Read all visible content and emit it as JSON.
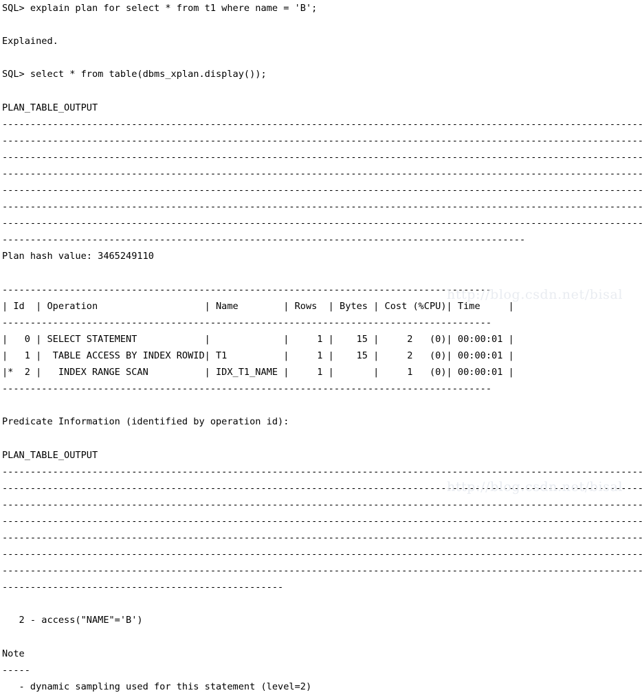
{
  "window": {
    "title": "SQL*Plus terminal output",
    "background_color": "#ffffff",
    "text_color": "#000000",
    "watermark_color": "#e9ecf1"
  },
  "watermark": {
    "text": "http://blog.csdn.net/bisal",
    "occurrences": 2
  },
  "session": {
    "prompt": "SQL>",
    "command_1": "SQL> explain plan for select * from t1 where name = 'B';",
    "result_1": "Explained.",
    "command_2": "SQL> select * from table(dbms_xplan.display());",
    "column_heading": "PLAN_TABLE_OUTPUT"
  },
  "plan": {
    "hash_label": "Plan hash value: 3465249110",
    "hash_value": "3465249110",
    "table_header": "| Id  | Operation                   | Name        | Rows  | Bytes | Cost (%CPU)| Time     |",
    "table_rule": "---------------------------------------------------------------------------------------",
    "columns": [
      "Id",
      "Operation",
      "Name",
      "Rows",
      "Bytes",
      "Cost (%CPU)",
      "Time"
    ],
    "rows": [
      {
        "line": "|   0 | SELECT STATEMENT            |             |     1 |    15 |     2   (0)| 00:00:01 |",
        "star": "",
        "id": "0",
        "operation": "SELECT STATEMENT",
        "name": "",
        "rows": "1",
        "bytes": "15",
        "cost": "2   (0)",
        "time": "00:00:01"
      },
      {
        "line": "|   1 |  TABLE ACCESS BY INDEX ROWID| T1          |     1 |    15 |     2   (0)| 00:00:01 |",
        "star": "",
        "id": "1",
        "operation": " TABLE ACCESS BY INDEX ROWID",
        "name": "T1",
        "rows": "1",
        "bytes": "15",
        "cost": "2   (0)",
        "time": "00:00:01"
      },
      {
        "line": "|*  2 |   INDEX RANGE SCAN          | IDX_T1_NAME |     1 |       |     1   (0)| 00:00:01 |",
        "star": "*",
        "id": "2",
        "operation": "  INDEX RANGE SCAN",
        "name": "IDX_T1_NAME",
        "rows": "1",
        "bytes": "",
        "cost": "1   (0)",
        "time": "00:00:01"
      }
    ]
  },
  "predicate": {
    "heading": "Predicate Information (identified by operation id):",
    "column_heading": "PLAN_TABLE_OUTPUT",
    "entries": [
      "   2 - access(\"NAME\"='B')"
    ]
  },
  "note": {
    "heading": "Note",
    "underline": "-----",
    "entries": [
      "   - dynamic sampling used for this statement (level=2)"
    ]
  },
  "separators": {
    "full_width_dashes": "------------------------------------------------------------------------------------------------------------------",
    "block1_tail_dashes": "---------------------------------------------------------------------------------------------",
    "block2_tail_dashes": "--------------------------------------------------"
  },
  "lines": [
    {
      "kind": "command",
      "text": "SQL> explain plan for select * from t1 where name = 'B';"
    },
    {
      "kind": "blank",
      "text": ""
    },
    {
      "kind": "result",
      "text": "Explained."
    },
    {
      "kind": "blank",
      "text": ""
    },
    {
      "kind": "command",
      "text": "SQL> select * from table(dbms_xplan.display());"
    },
    {
      "kind": "blank",
      "text": ""
    },
    {
      "kind": "heading",
      "text": "PLAN_TABLE_OUTPUT"
    },
    {
      "kind": "separator",
      "text": "------------------------------------------------------------------------------------------------------------------"
    },
    {
      "kind": "separator",
      "text": "------------------------------------------------------------------------------------------------------------------"
    },
    {
      "kind": "separator",
      "text": "------------------------------------------------------------------------------------------------------------------"
    },
    {
      "kind": "separator",
      "text": "------------------------------------------------------------------------------------------------------------------"
    },
    {
      "kind": "separator",
      "text": "------------------------------------------------------------------------------------------------------------------"
    },
    {
      "kind": "separator",
      "text": "------------------------------------------------------------------------------------------------------------------"
    },
    {
      "kind": "separator",
      "text": "------------------------------------------------------------------------------------------------------------------"
    },
    {
      "kind": "separator",
      "text": "---------------------------------------------------------------------------------------------"
    },
    {
      "kind": "planhash",
      "text": "Plan hash value: 3465249110"
    },
    {
      "kind": "blank",
      "text": ""
    },
    {
      "kind": "tablerule",
      "text": "---------------------------------------------------------------------------------------"
    },
    {
      "kind": "tablehead",
      "text": "| Id  | Operation                   | Name        | Rows  | Bytes | Cost (%CPU)| Time     |"
    },
    {
      "kind": "tablerule",
      "text": "---------------------------------------------------------------------------------------"
    },
    {
      "kind": "tablerow",
      "text": "|   0 | SELECT STATEMENT            |             |     1 |    15 |     2   (0)| 00:00:01 |"
    },
    {
      "kind": "tablerow",
      "text": "|   1 |  TABLE ACCESS BY INDEX ROWID| T1          |     1 |    15 |     2   (0)| 00:00:01 |"
    },
    {
      "kind": "tablerow",
      "text": "|*  2 |   INDEX RANGE SCAN          | IDX_T1_NAME |     1 |       |     1   (0)| 00:00:01 |"
    },
    {
      "kind": "tablerule",
      "text": "---------------------------------------------------------------------------------------"
    },
    {
      "kind": "blank",
      "text": ""
    },
    {
      "kind": "heading",
      "text": "Predicate Information (identified by operation id):"
    },
    {
      "kind": "blank",
      "text": ""
    },
    {
      "kind": "heading",
      "text": "PLAN_TABLE_OUTPUT"
    },
    {
      "kind": "separator",
      "text": "------------------------------------------------------------------------------------------------------------------"
    },
    {
      "kind": "separator",
      "text": "------------------------------------------------------------------------------------------------------------------"
    },
    {
      "kind": "separator",
      "text": "------------------------------------------------------------------------------------------------------------------"
    },
    {
      "kind": "separator",
      "text": "------------------------------------------------------------------------------------------------------------------"
    },
    {
      "kind": "separator",
      "text": "------------------------------------------------------------------------------------------------------------------"
    },
    {
      "kind": "separator",
      "text": "------------------------------------------------------------------------------------------------------------------"
    },
    {
      "kind": "separator",
      "text": "------------------------------------------------------------------------------------------------------------------"
    },
    {
      "kind": "separator",
      "text": "--------------------------------------------------"
    },
    {
      "kind": "blank",
      "text": ""
    },
    {
      "kind": "predicate",
      "text": "   2 - access(\"NAME\"='B')"
    },
    {
      "kind": "blank",
      "text": ""
    },
    {
      "kind": "heading",
      "text": "Note"
    },
    {
      "kind": "separator",
      "text": "-----"
    },
    {
      "kind": "noteitem",
      "text": "   - dynamic sampling used for this statement (level=2)"
    }
  ]
}
